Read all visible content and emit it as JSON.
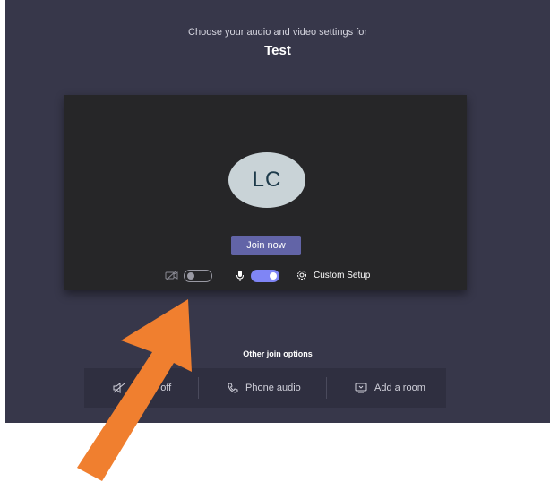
{
  "header": {
    "subtitle": "Choose your audio and video settings for",
    "title": "Test"
  },
  "preview": {
    "avatar_initials": "LC",
    "join_label": "Join now",
    "camera_toggle": "off",
    "mic_toggle": "on",
    "custom_setup_label": "Custom Setup"
  },
  "other_options": {
    "heading": "Other join options",
    "items": [
      {
        "label": "Audio off",
        "icon": "speaker-off-icon"
      },
      {
        "label": "Phone audio",
        "icon": "phone-icon"
      },
      {
        "label": "Add a room",
        "icon": "cast-screen-icon"
      }
    ]
  },
  "colors": {
    "background": "#37374a",
    "accent": "#6264a7",
    "toggle_on": "#7f85f5",
    "arrow": "#f07f2f"
  }
}
